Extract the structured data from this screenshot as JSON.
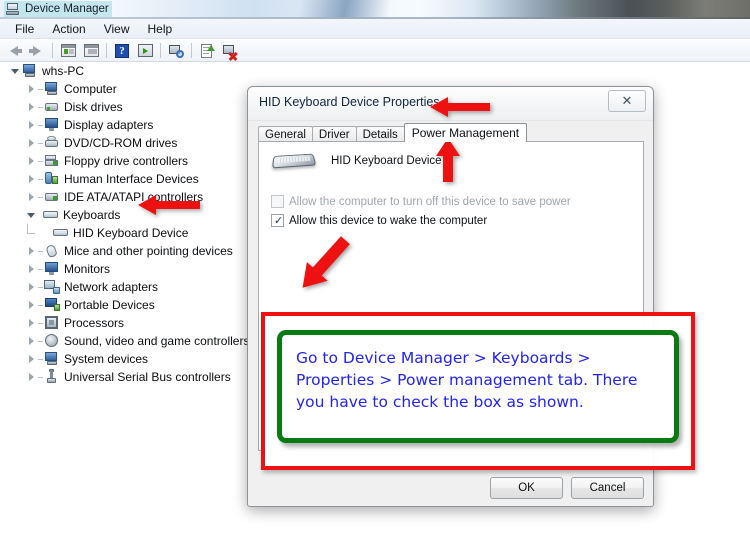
{
  "window": {
    "title": "Device Manager",
    "icon": "device-manager-icon"
  },
  "menubar": {
    "items": [
      {
        "label": "File"
      },
      {
        "label": "Action"
      },
      {
        "label": "View"
      },
      {
        "label": "Help"
      }
    ]
  },
  "toolbar": {
    "buttons": [
      {
        "icon": "back-arrow-icon",
        "label": "Back"
      },
      {
        "icon": "forward-arrow-icon",
        "label": "Forward"
      },
      {
        "icon": "show-hidden-devices-icon",
        "label": "Show hidden devices"
      },
      {
        "icon": "properties-icon",
        "label": "Properties"
      },
      {
        "icon": "help-icon",
        "label": "Help"
      },
      {
        "icon": "console-icon",
        "label": "Console"
      },
      {
        "icon": "scan-for-hardware-changes-icon",
        "label": "Scan for hardware changes"
      },
      {
        "icon": "update-driver-icon",
        "label": "Update Driver Software"
      },
      {
        "icon": "uninstall-device-icon",
        "label": "Uninstall"
      }
    ]
  },
  "tree": {
    "root": {
      "label": "whs-PC",
      "icon": "computer-root-icon",
      "expanded": true
    },
    "nodes": [
      {
        "label": "Computer",
        "icon": "computer-icon",
        "expanded": false
      },
      {
        "label": "Disk drives",
        "icon": "disk-drive-icon",
        "expanded": false
      },
      {
        "label": "Display adapters",
        "icon": "display-adapter-icon",
        "expanded": false
      },
      {
        "label": "DVD/CD-ROM drives",
        "icon": "dvd-drive-icon",
        "expanded": false
      },
      {
        "label": "Floppy drive controllers",
        "icon": "floppy-controller-icon",
        "expanded": false
      },
      {
        "label": "Human Interface Devices",
        "icon": "hid-icon",
        "expanded": false
      },
      {
        "label": "IDE ATA/ATAPI controllers",
        "icon": "ide-controller-icon",
        "expanded": false
      },
      {
        "label": "Keyboards",
        "icon": "keyboard-icon",
        "expanded": true
      },
      {
        "label": "Mice and other pointing devices",
        "icon": "mouse-icon",
        "expanded": false
      },
      {
        "label": "Monitors",
        "icon": "monitor-icon",
        "expanded": false
      },
      {
        "label": "Network adapters",
        "icon": "network-adapter-icon",
        "expanded": false
      },
      {
        "label": "Portable Devices",
        "icon": "portable-device-icon",
        "expanded": false
      },
      {
        "label": "Processors",
        "icon": "processor-icon",
        "expanded": false
      },
      {
        "label": "Sound, video and game controllers",
        "icon": "sound-controller-icon",
        "expanded": false
      },
      {
        "label": "System devices",
        "icon": "system-device-icon",
        "expanded": false
      },
      {
        "label": "Universal Serial Bus controllers",
        "icon": "usb-controller-icon",
        "expanded": false
      }
    ],
    "keyboard_child": {
      "label": "HID Keyboard Device",
      "icon": "keyboard-icon"
    }
  },
  "dialog": {
    "title": "HID Keyboard Device Properties",
    "close_label": "✕",
    "tabs": [
      {
        "label": "General",
        "active": false
      },
      {
        "label": "Driver",
        "active": false
      },
      {
        "label": "Details",
        "active": false
      },
      {
        "label": "Power Management",
        "active": true
      }
    ],
    "device_name": "HID Keyboard Device",
    "checkboxes": [
      {
        "label": "Allow the computer to turn off this device to save power",
        "checked": false,
        "disabled": true,
        "tick": ""
      },
      {
        "label": "Allow this device to wake the computer",
        "checked": true,
        "disabled": false,
        "tick": "✓"
      }
    ],
    "buttons": [
      {
        "label": "OK"
      },
      {
        "label": "Cancel"
      }
    ]
  },
  "annotation": {
    "text": "Go to Device Manager > Keyboards > Properties > Power management tab. There you have to check the box as shown.",
    "box_border_color": "#0a7a12",
    "outer_border_color": "#ee1111",
    "text_color": "#2323ee",
    "arrows": [
      {
        "name": "arrow-to-keyboards",
        "direction": "left"
      },
      {
        "name": "arrow-to-dialog-title",
        "direction": "left"
      },
      {
        "name": "arrow-to-power-management-tab",
        "direction": "up"
      },
      {
        "name": "arrow-to-wake-checkbox",
        "direction": "up-left"
      }
    ]
  }
}
